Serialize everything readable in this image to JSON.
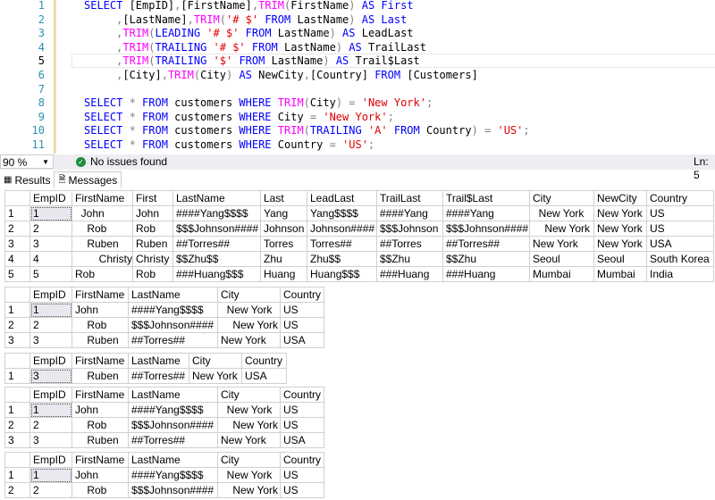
{
  "editor": {
    "lines": [
      [
        [
          "kw",
          "SELECT "
        ],
        [
          "",
          "[EmpID]"
        ],
        [
          "op",
          ","
        ],
        [
          "",
          "[FirstName]"
        ],
        [
          "op",
          ","
        ],
        [
          "fn",
          "TRIM"
        ],
        [
          "op",
          "("
        ],
        [
          "",
          "FirstName"
        ],
        [
          "op",
          ")"
        ],
        [
          "kw",
          " AS "
        ],
        [
          "kw",
          "First"
        ]
      ],
      [
        [
          "op",
          "     ,"
        ],
        [
          "",
          "[LastName]"
        ],
        [
          "op",
          ","
        ],
        [
          "fn",
          "TRIM"
        ],
        [
          "op",
          "("
        ],
        [
          "str",
          "'# $'"
        ],
        [
          "kw",
          " FROM "
        ],
        [
          "",
          "LastName"
        ],
        [
          "op",
          ")"
        ],
        [
          "kw",
          " AS "
        ],
        [
          "kw",
          "Last"
        ]
      ],
      [
        [
          "op",
          "     ,"
        ],
        [
          "fn",
          "TRIM"
        ],
        [
          "op",
          "("
        ],
        [
          "kw",
          "LEADING "
        ],
        [
          "str",
          "'# $'"
        ],
        [
          "kw",
          " FROM "
        ],
        [
          "",
          "LastName"
        ],
        [
          "op",
          ")"
        ],
        [
          "kw",
          " AS "
        ],
        [
          "",
          "LeadLast"
        ]
      ],
      [
        [
          "op",
          "     ,"
        ],
        [
          "fn",
          "TRIM"
        ],
        [
          "op",
          "("
        ],
        [
          "kw",
          "TRAILING "
        ],
        [
          "str",
          "'# $'"
        ],
        [
          "kw",
          " FROM "
        ],
        [
          "",
          "LastName"
        ],
        [
          "op",
          ")"
        ],
        [
          "kw",
          " AS "
        ],
        [
          "",
          "TrailLast"
        ]
      ],
      [
        [
          "op",
          "     ,"
        ],
        [
          "fn",
          "TRIM"
        ],
        [
          "op",
          "("
        ],
        [
          "kw",
          "TRAILING "
        ],
        [
          "str",
          "'$'"
        ],
        [
          "kw",
          " FROM "
        ],
        [
          "",
          "LastName"
        ],
        [
          "op",
          ")"
        ],
        [
          "kw",
          " AS "
        ],
        [
          "",
          "Trail$Last"
        ]
      ],
      [
        [
          "op",
          "     ,"
        ],
        [
          "",
          "[City]"
        ],
        [
          "op",
          ","
        ],
        [
          "fn",
          "TRIM"
        ],
        [
          "op",
          "("
        ],
        [
          "",
          "City"
        ],
        [
          "op",
          ")"
        ],
        [
          "kw",
          " AS "
        ],
        [
          "",
          "NewCity"
        ],
        [
          "op",
          ","
        ],
        [
          "",
          "[Country]"
        ],
        [
          "kw",
          " FROM "
        ],
        [
          "",
          "[Customers]"
        ]
      ],
      [],
      [
        [
          "kw",
          "SELECT "
        ],
        [
          "op",
          "* "
        ],
        [
          "kw",
          "FROM "
        ],
        [
          "",
          "customers "
        ],
        [
          "kw",
          "WHERE "
        ],
        [
          "fn",
          "TRIM"
        ],
        [
          "op",
          "("
        ],
        [
          "",
          "City"
        ],
        [
          "op",
          ") = "
        ],
        [
          "str",
          "'New York'"
        ],
        [
          "op",
          ";"
        ]
      ],
      [
        [
          "kw",
          "SELECT "
        ],
        [
          "op",
          "* "
        ],
        [
          "kw",
          "FROM "
        ],
        [
          "",
          "customers "
        ],
        [
          "kw",
          "WHERE "
        ],
        [
          "",
          "City "
        ],
        [
          "op",
          "= "
        ],
        [
          "str",
          "'New York'"
        ],
        [
          "op",
          ";"
        ]
      ],
      [
        [
          "kw",
          "SELECT "
        ],
        [
          "op",
          "* "
        ],
        [
          "kw",
          "FROM "
        ],
        [
          "",
          "customers "
        ],
        [
          "kw",
          "WHERE "
        ],
        [
          "fn",
          "TRIM"
        ],
        [
          "op",
          "("
        ],
        [
          "kw",
          "TRAILING "
        ],
        [
          "str",
          "'A'"
        ],
        [
          "kw",
          " FROM "
        ],
        [
          "",
          "Country"
        ],
        [
          "op",
          ") = "
        ],
        [
          "str",
          "'US'"
        ],
        [
          "op",
          ";"
        ]
      ],
      [
        [
          "kw",
          "SELECT "
        ],
        [
          "op",
          "* "
        ],
        [
          "kw",
          "FROM "
        ],
        [
          "",
          "customers "
        ],
        [
          "kw",
          "WHERE "
        ],
        [
          "",
          "Country "
        ],
        [
          "op",
          "= "
        ],
        [
          "str",
          "'US'"
        ],
        [
          "op",
          ";"
        ]
      ]
    ],
    "current_line": 5
  },
  "status": {
    "zoom": "90 %",
    "issues": "No issues found",
    "position": "Ln: 5"
  },
  "tabs": {
    "results": "Results",
    "messages": "Messages"
  },
  "grids": [
    {
      "columns": [
        "",
        "EmpID",
        "FirstName",
        "First",
        "LastName",
        "Last",
        "LeadLast",
        "TrailLast",
        "Trail$Last",
        "City",
        "NewCity",
        "Country"
      ],
      "rows": [
        [
          "1",
          "1",
          "  John",
          "John",
          "####Yang$$$$",
          "Yang",
          "Yang$$$$",
          "####Yang",
          "####Yang",
          "  New York",
          "New York",
          "US"
        ],
        [
          "2",
          "2",
          "    Rob",
          "Rob",
          "$$$Johnson####",
          "Johnson",
          "Johnson####",
          "$$$Johnson",
          "$$$Johnson####",
          "    New York",
          "New York",
          "US"
        ],
        [
          "3",
          "3",
          "    Ruben",
          "Ruben",
          "##Torres##",
          "Torres",
          "Torres##",
          "##Torres",
          "##Torres##",
          "New York",
          "New York",
          "USA"
        ],
        [
          "4",
          "4",
          "        Christy",
          "Christy",
          "$$Zhu$$",
          "Zhu",
          "Zhu$$",
          "$$Zhu",
          "$$Zhu",
          "Seoul",
          "Seoul",
          "South Korea"
        ],
        [
          "5",
          "5",
          "Rob",
          "Rob",
          "###Huang$$$",
          "Huang",
          "Huang$$$",
          "###Huang",
          "###Huang",
          "Mumbai",
          "Mumbai",
          "India"
        ]
      ]
    },
    {
      "columns": [
        "",
        "EmpID",
        "FirstName",
        "LastName",
        "City",
        "Country"
      ],
      "rows": [
        [
          "1",
          "1",
          "John",
          "####Yang$$$$",
          "  New York",
          "US"
        ],
        [
          "2",
          "2",
          "    Rob",
          "$$$Johnson####",
          "    New York",
          "US"
        ],
        [
          "3",
          "3",
          "    Ruben",
          "##Torres##",
          "New York",
          "USA"
        ]
      ]
    },
    {
      "columns": [
        "",
        "EmpID",
        "FirstName",
        "LastName",
        "City",
        "Country"
      ],
      "rows": [
        [
          "1",
          "3",
          "    Ruben",
          "##Torres##",
          "New York",
          "USA"
        ]
      ]
    },
    {
      "columns": [
        "",
        "EmpID",
        "FirstName",
        "LastName",
        "City",
        "Country"
      ],
      "rows": [
        [
          "1",
          "1",
          "John",
          "####Yang$$$$",
          "  New York",
          "US"
        ],
        [
          "2",
          "2",
          "    Rob",
          "$$$Johnson####",
          "    New York",
          "US"
        ],
        [
          "3",
          "3",
          "    Ruben",
          "##Torres##",
          "New York",
          "USA"
        ]
      ]
    },
    {
      "columns": [
        "",
        "EmpID",
        "FirstName",
        "LastName",
        "City",
        "Country"
      ],
      "rows": [
        [
          "1",
          "1",
          "John",
          "####Yang$$$$",
          "  New York",
          "US"
        ],
        [
          "2",
          "2",
          "    Rob",
          "$$$Johnson####",
          "    New York",
          "US"
        ]
      ]
    }
  ]
}
